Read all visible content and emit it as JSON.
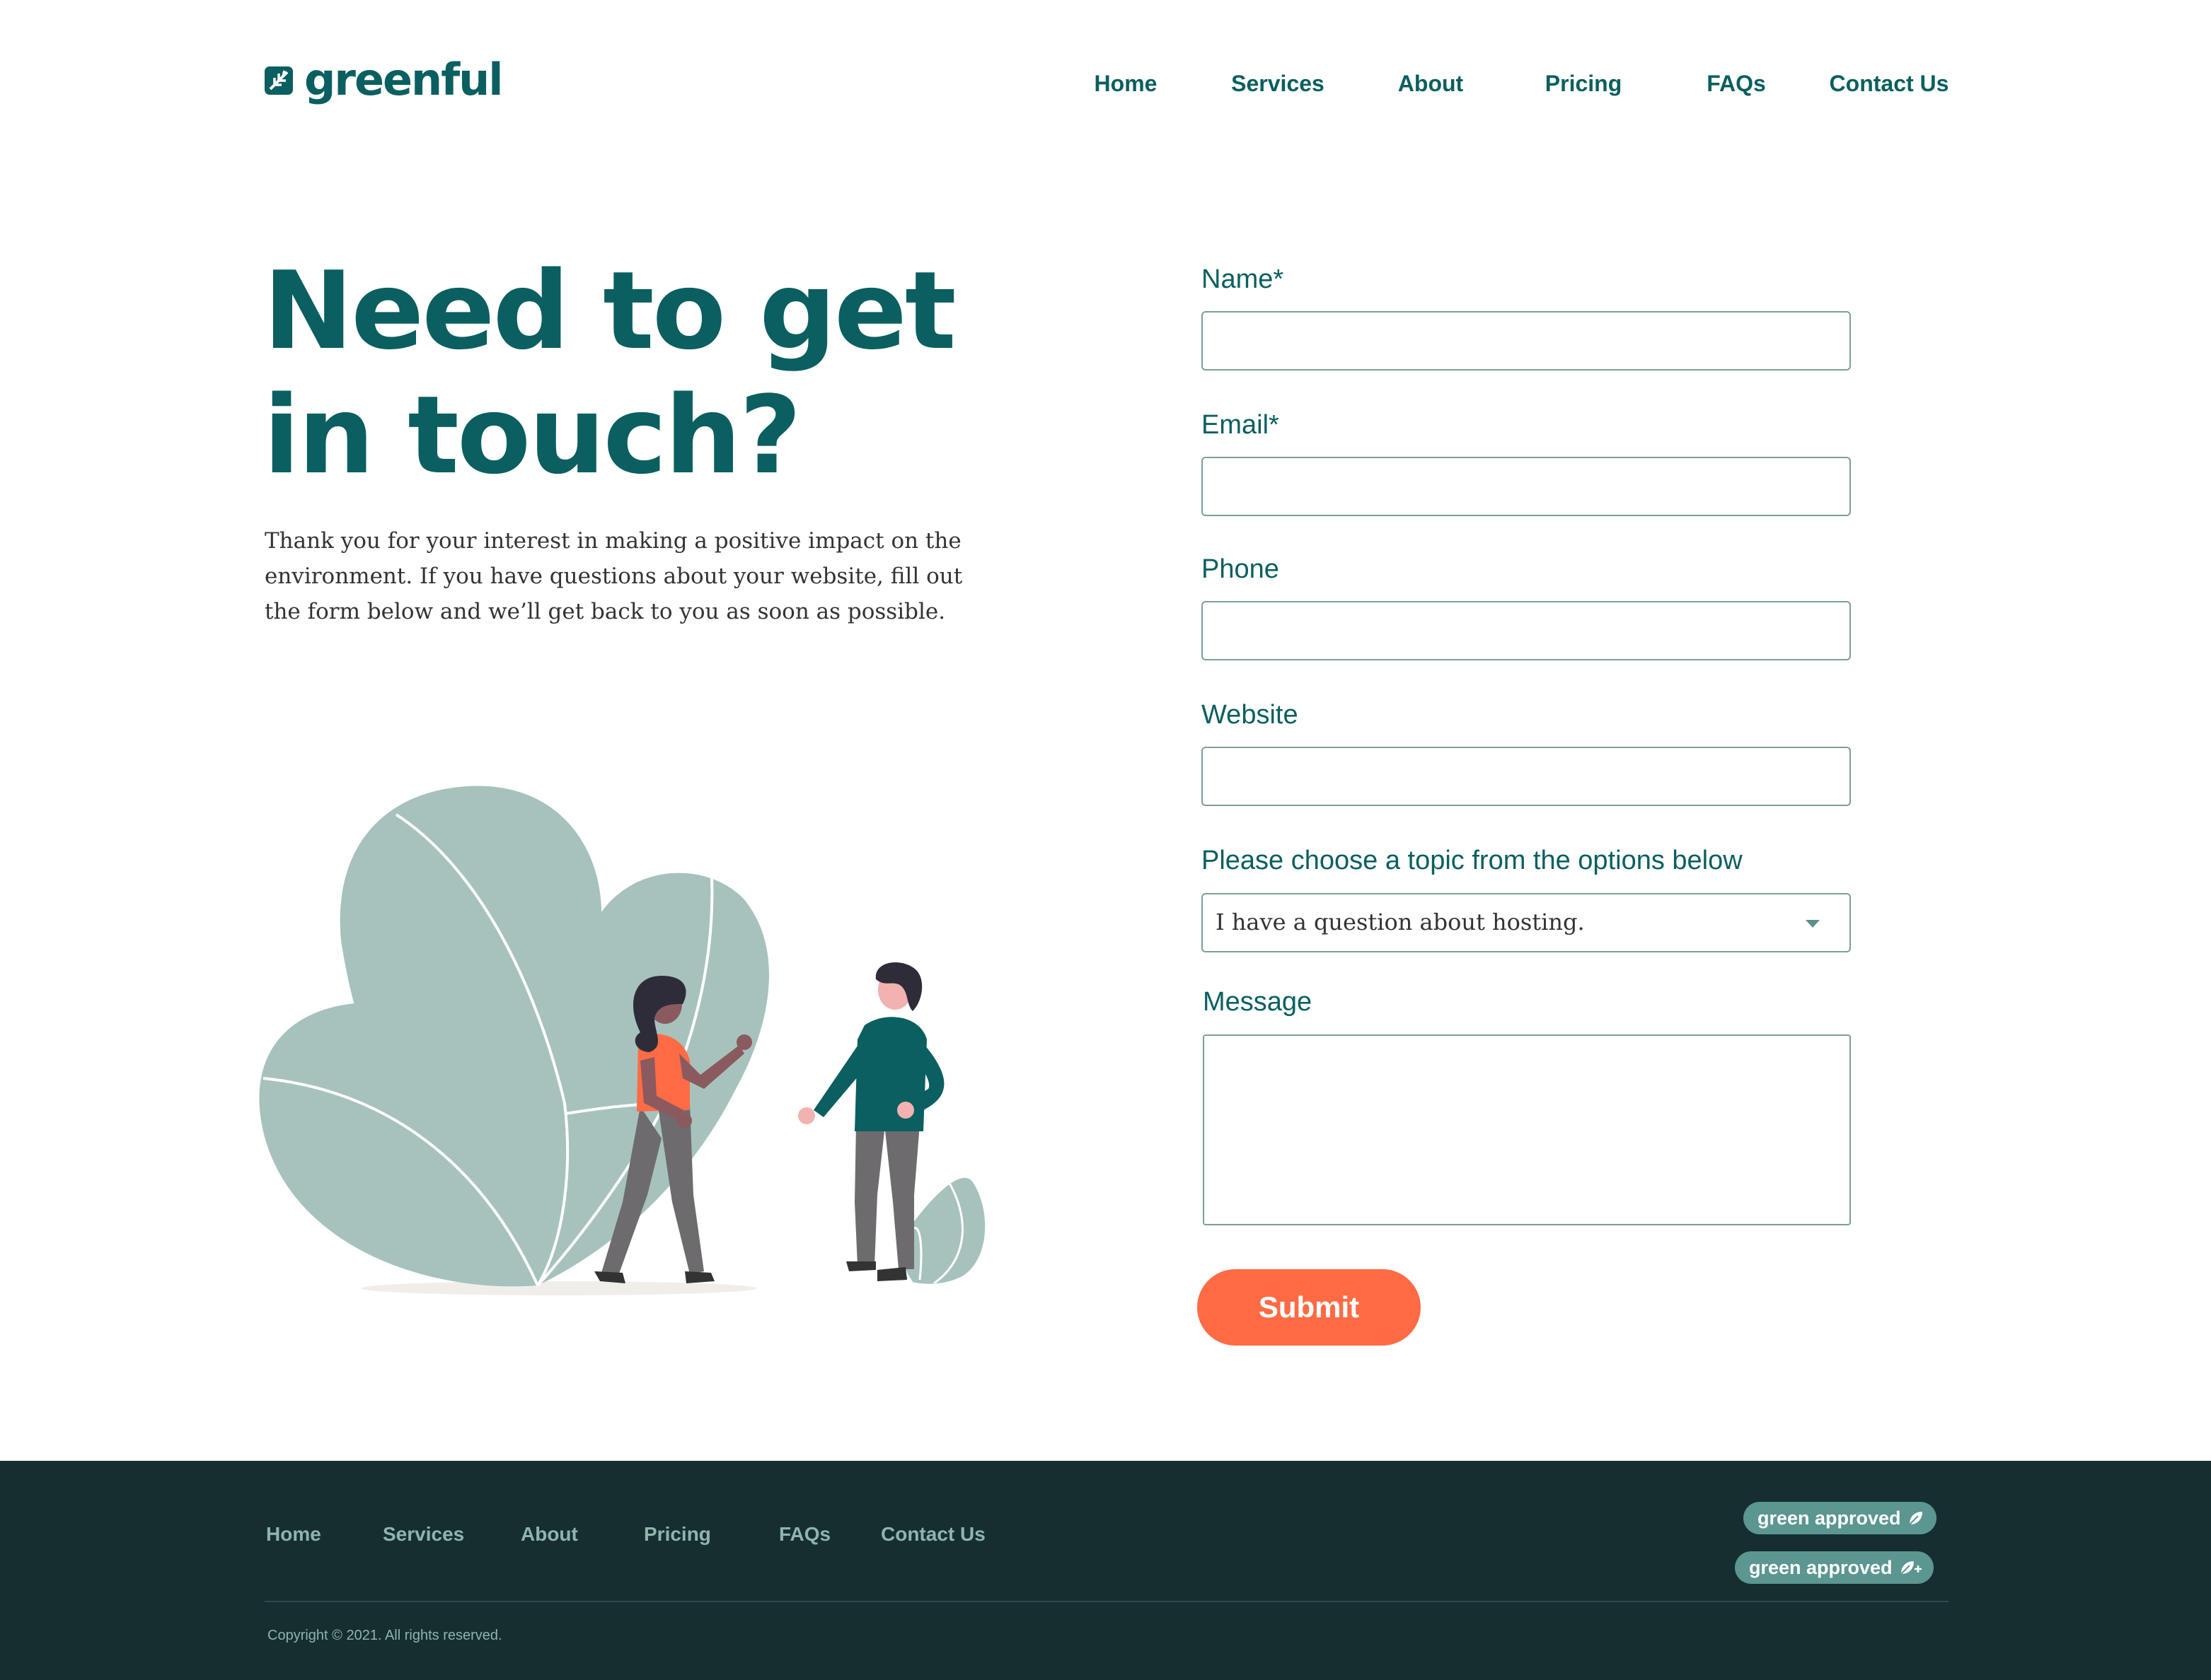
{
  "brand": {
    "name": "greenful",
    "logo_icon": "leaf-square-icon",
    "color": "#0b5f60"
  },
  "nav": {
    "items": [
      {
        "label": "Home"
      },
      {
        "label": "Services"
      },
      {
        "label": "About"
      },
      {
        "label": "Pricing"
      },
      {
        "label": "FAQs"
      },
      {
        "label": "Contact Us"
      }
    ]
  },
  "hero": {
    "title": "Need to get in touch?",
    "copy": "Thank you for your interest in making a positive impact on the environment. If you have questions about your website, fill out the form below and we’ll get back to you as soon as possible."
  },
  "form": {
    "name_label": "Name*",
    "name_value": "",
    "email_label": "Email*",
    "email_value": "",
    "phone_label": "Phone",
    "phone_value": "",
    "website_label": "Website",
    "website_value": "",
    "topic_label": "Please choose a topic from the options below",
    "topic_value": "I have a question about hosting.",
    "message_label": "Message",
    "message_value": "",
    "submit_label": "Submit"
  },
  "footer": {
    "nav": [
      {
        "label": "Home"
      },
      {
        "label": "Services"
      },
      {
        "label": "About"
      },
      {
        "label": "Pricing"
      },
      {
        "label": "FAQs"
      },
      {
        "label": "Contact Us"
      }
    ],
    "badges": [
      {
        "label": "green approved",
        "icon": "leaf-icon"
      },
      {
        "label": "green approved",
        "icon": "leaf-plus-icon"
      }
    ],
    "copyright": "Copyright © 2021. All rights reserved."
  },
  "colors": {
    "primary": "#0b5f60",
    "accent": "#ff6b45",
    "footer_bg": "#162e30",
    "footer_text": "#8fb4ae",
    "leaf": "#a7c2bd",
    "badge": "#5b9690"
  }
}
